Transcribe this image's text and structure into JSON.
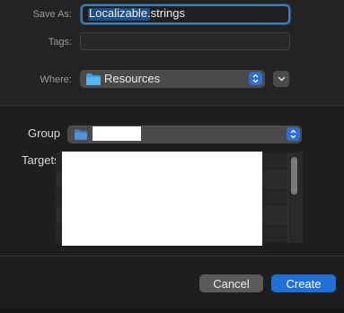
{
  "save_as": {
    "label": "Save As:",
    "name_selected": "Localizable",
    "name_extension": ".strings"
  },
  "tags": {
    "label": "Tags:",
    "value": ""
  },
  "where": {
    "label": "Where:",
    "value": "Resources",
    "icon": "folder-icon",
    "expand_icon": "chevron-down-icon"
  },
  "group": {
    "label": "Group",
    "icon": "folder-icon"
  },
  "targets": {
    "label": "Targets"
  },
  "buttons": {
    "cancel": "Cancel",
    "create": "Create"
  },
  "colors": {
    "accent": "#1f6fd6",
    "background": "#1e1e1e",
    "focus_ring": "#3d7bb5"
  }
}
